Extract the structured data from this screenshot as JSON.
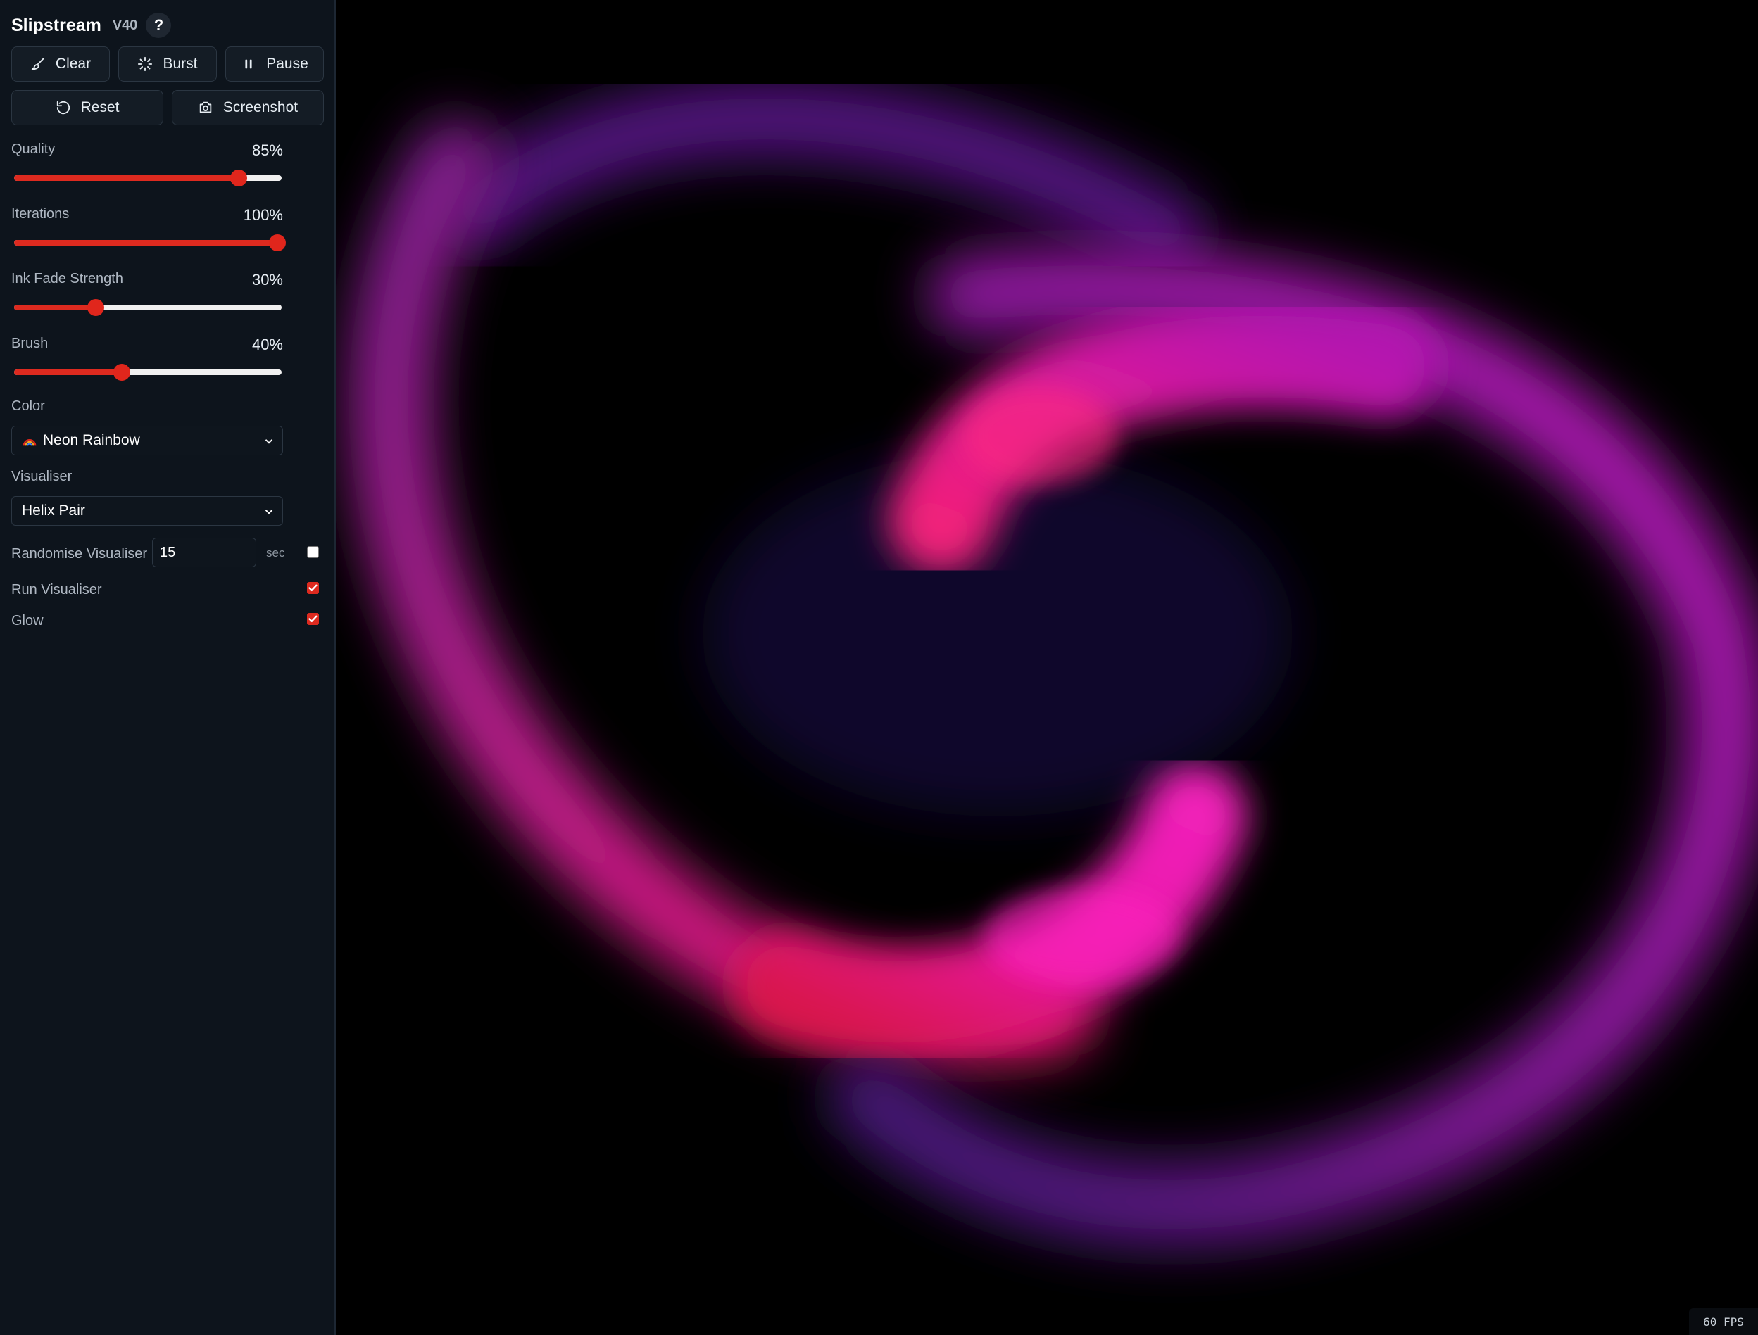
{
  "app": {
    "title": "Slipstream",
    "version": "V40",
    "help": "?"
  },
  "toolbar": {
    "clear": {
      "label": "Clear",
      "icon": "brush-icon"
    },
    "burst": {
      "label": "Burst",
      "icon": "burst-icon"
    },
    "pause": {
      "label": "Pause",
      "icon": "pause-icon"
    },
    "reset": {
      "label": "Reset",
      "icon": "reset-icon"
    },
    "screenshot": {
      "label": "Screenshot",
      "icon": "camera-icon"
    }
  },
  "sliders": {
    "quality": {
      "label": "Quality",
      "display": "85%",
      "value": 0.85
    },
    "iterations": {
      "label": "Iterations",
      "display": "100%",
      "value": 1.0
    },
    "ink_fade": {
      "label": "Ink Fade Strength",
      "display": "30%",
      "value": 0.3
    },
    "brush": {
      "label": "Brush",
      "display": "40%",
      "value": 0.4
    }
  },
  "color": {
    "label": "Color",
    "selected": "Neon Rainbow",
    "icon": "rainbow-icon"
  },
  "visualiser": {
    "label": "Visualiser",
    "selected": "Helix Pair"
  },
  "randomise": {
    "label": "Randomise Visualiser",
    "value": "15",
    "unit": "sec",
    "checked": false
  },
  "run_visualiser": {
    "label": "Run Visualiser",
    "checked": true
  },
  "glow": {
    "label": "Glow",
    "checked": true
  },
  "status": {
    "fps": "60 FPS"
  },
  "theme": {
    "accent": "#dd2a1f",
    "sidebar_bg": "#0d141c",
    "canvas_bg": "#000000"
  }
}
